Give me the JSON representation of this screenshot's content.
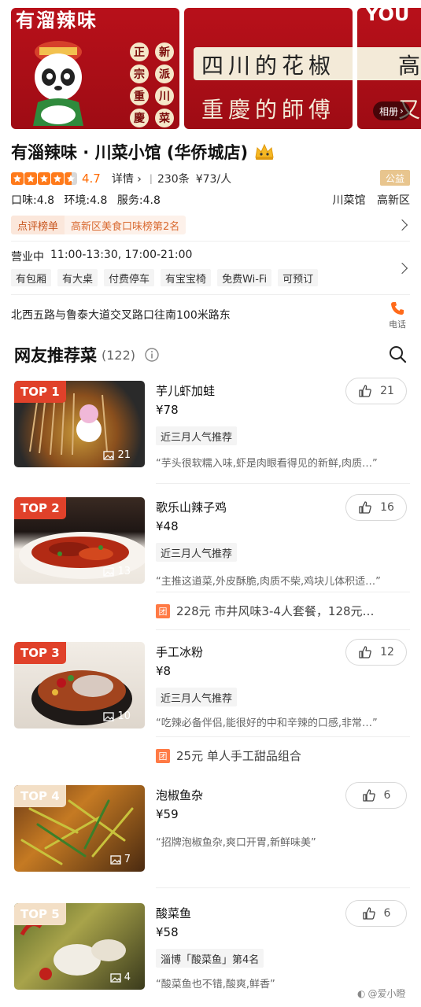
{
  "banner": {
    "card1_title": "有溜辣味",
    "card1_col1": [
      "正",
      "宗",
      "重",
      "慶"
    ],
    "card1_col2": [
      "新",
      "派",
      "川",
      "菜"
    ],
    "card2_line1": "四川的花椒",
    "card2_line2": "重慶的師傅",
    "card3_top": "YOU",
    "card3_line1": "高",
    "card3_line2": "又",
    "album_label": "相册"
  },
  "shop": {
    "title": "有淄辣味 · 川菜小馆 (华侨城店)",
    "rating": "4.7",
    "rating_value": 4.7,
    "detail_label": "详情",
    "review_count": "230条",
    "avg_price": "¥73/人",
    "badge": "公益",
    "scores": [
      "口味:4.8",
      "环境:4.8",
      "服务:4.8"
    ],
    "category": "川菜馆",
    "district": "高新区",
    "rank_tag": "点评榜单",
    "rank_text": "高新区美食口味榜第2名",
    "hours_label": "营业中",
    "hours": "11:00-13:30, 17:00-21:00",
    "amenities": [
      "有包厢",
      "有大桌",
      "付费停车",
      "有宝宝椅",
      "免费Wi-Fi",
      "可预订"
    ],
    "address": "北西五路与鲁泰大道交叉路口往南100米路东",
    "phone_label": "电话"
  },
  "dishes_section": {
    "title": "网友推荐菜",
    "count": "(122)"
  },
  "dishes": [
    {
      "rank": "TOP 1",
      "name": "芋儿虾加蛙",
      "price": "¥78",
      "photos": "21",
      "likes": "21",
      "tag": "近三月人气推荐",
      "quote": "“芋头很软糯入味,虾是肉眼看得见的新鲜,肉质…”"
    },
    {
      "rank": "TOP 2",
      "name": "歌乐山辣子鸡",
      "price": "¥48",
      "photos": "13",
      "likes": "16",
      "tag": "近三月人气推荐",
      "quote": "“主推这道菜,外皮酥脆,肉质不柴,鸡块儿体积适…”",
      "deal": "228元 市井风味3-4人套餐，128元…"
    },
    {
      "rank": "TOP 3",
      "name": "手工冰粉",
      "price": "¥8",
      "photos": "10",
      "likes": "12",
      "tag": "近三月人气推荐",
      "quote": "“吃辣必备伴侣,能很好的中和辛辣的口感,非常…”",
      "deal": "25元 单人手工甜品组合"
    },
    {
      "rank": "TOP 4",
      "name": "泡椒鱼杂",
      "price": "¥59",
      "photos": "7",
      "likes": "6",
      "quote": "“招牌泡椒鱼杂,爽口开胃,新鲜味美”"
    },
    {
      "rank": "TOP 5",
      "name": "酸菜鱼",
      "price": "¥58",
      "photos": "4",
      "likes": "6",
      "tag": "淄博「酸菜鱼」第4名",
      "quote": "“酸菜鱼也不错,酸爽,鲜香”"
    }
  ],
  "deal_icon_label": "团",
  "watermark": "@爱小瞪",
  "colors": {
    "accent": "#ff6a00",
    "top_badge": "#e0412a",
    "banner": "#b8101a"
  },
  "icons": [
    "camera-icon",
    "search-icon",
    "info-icon",
    "like-icon",
    "phone-icon",
    "crown-icon",
    "star-icon",
    "chevron-right-icon",
    "image-icon"
  ]
}
